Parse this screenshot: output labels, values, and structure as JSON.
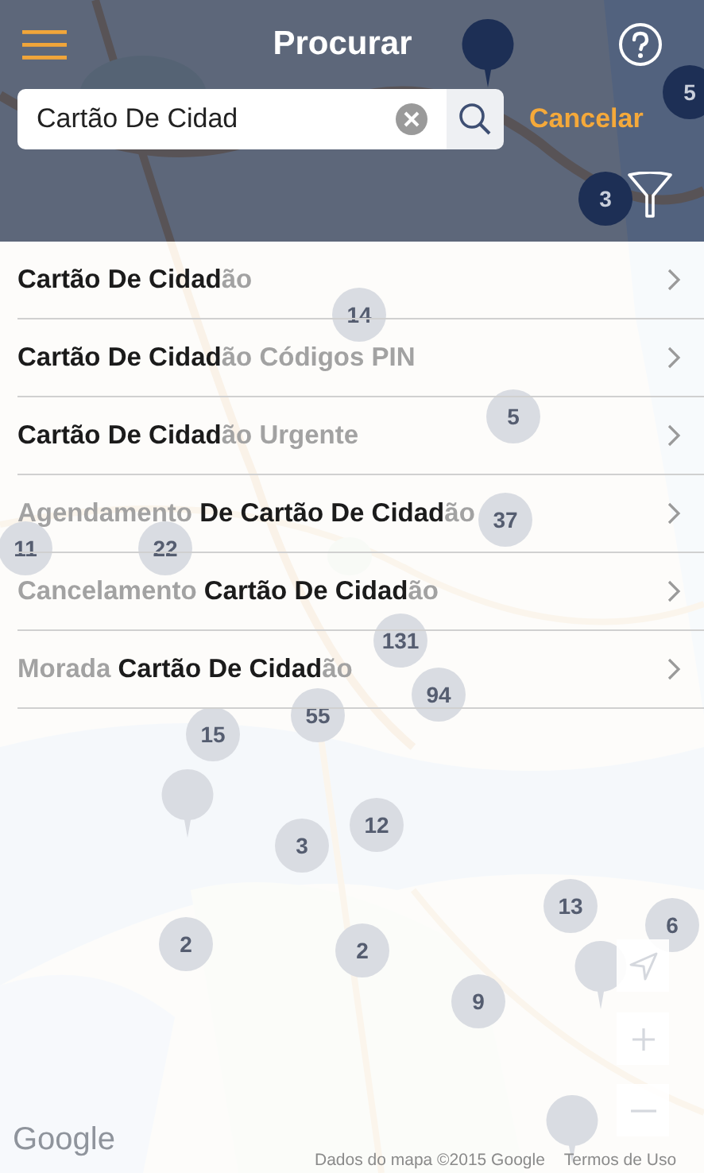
{
  "header": {
    "title": "Procurar"
  },
  "search": {
    "value": "Cartão De Cidad"
  },
  "cancel_label": "Cancelar",
  "results": [
    {
      "segments": [
        {
          "text": "Cartão De Cidad",
          "match": true
        },
        {
          "text": "ão",
          "match": false
        }
      ]
    },
    {
      "segments": [
        {
          "text": "Cartão De Cidad",
          "match": true
        },
        {
          "text": "ão Códigos PIN",
          "match": false
        }
      ]
    },
    {
      "segments": [
        {
          "text": "Cartão De Cidad",
          "match": true
        },
        {
          "text": "ão Urgente",
          "match": false
        }
      ]
    },
    {
      "segments": [
        {
          "text": "Agendamento ",
          "match": false
        },
        {
          "text": "De Cartão De Cidad",
          "match": true
        },
        {
          "text": "ão",
          "match": false
        }
      ]
    },
    {
      "segments": [
        {
          "text": "Cancelamento ",
          "match": false
        },
        {
          "text": "Cartão De Cidad",
          "match": true
        },
        {
          "text": "ão",
          "match": false
        }
      ]
    },
    {
      "segments": [
        {
          "text": "Morada ",
          "match": false
        },
        {
          "text": "Cartão De Cidad",
          "match": true
        },
        {
          "text": "ão",
          "match": false
        }
      ]
    }
  ],
  "map": {
    "markers": [
      {
        "kind": "pin"
      },
      {
        "kind": "cluster",
        "count": "5"
      },
      {
        "kind": "cluster",
        "count": "3"
      },
      {
        "kind": "cluster",
        "count": "14"
      },
      {
        "kind": "cluster",
        "count": "5"
      },
      {
        "kind": "cluster",
        "count": "37"
      },
      {
        "kind": "cluster",
        "count": "11"
      },
      {
        "kind": "cluster",
        "count": "22"
      },
      {
        "kind": "cluster",
        "count": "131"
      },
      {
        "kind": "cluster",
        "count": "94"
      },
      {
        "kind": "cluster",
        "count": "55"
      },
      {
        "kind": "cluster",
        "count": "15"
      },
      {
        "kind": "pin"
      },
      {
        "kind": "cluster",
        "count": "3"
      },
      {
        "kind": "cluster",
        "count": "12"
      },
      {
        "kind": "cluster",
        "count": "2"
      },
      {
        "kind": "cluster",
        "count": "2"
      },
      {
        "kind": "cluster",
        "count": "13"
      },
      {
        "kind": "cluster",
        "count": "6"
      },
      {
        "kind": "pin"
      },
      {
        "kind": "cluster",
        "count": "9"
      },
      {
        "kind": "pin"
      }
    ],
    "logo": "Google",
    "attribution": "Dados do mapa ©2015 Google",
    "terms": "Termos de Uso"
  }
}
